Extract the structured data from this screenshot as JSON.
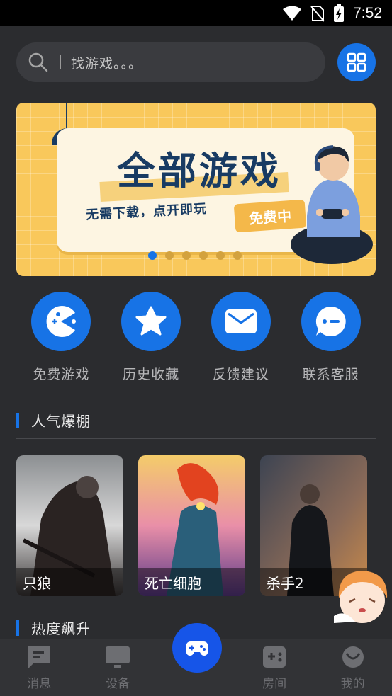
{
  "status_bar": {
    "time": "7:52"
  },
  "search": {
    "placeholder": "找游戏。。。"
  },
  "banner": {
    "title": "全部游戏",
    "subtitle": "无需下载，点开即玩",
    "badge": "免费中",
    "slides": 6,
    "active_slide": 1
  },
  "actions": [
    {
      "label": "免费游戏",
      "icon": "pacman-icon"
    },
    {
      "label": "历史收藏",
      "icon": "star-icon"
    },
    {
      "label": "反馈建议",
      "icon": "mail-icon"
    },
    {
      "label": "联系客服",
      "icon": "chat-icon"
    }
  ],
  "sections": {
    "popular": "人气爆棚",
    "rising": "热度飙升"
  },
  "games": [
    {
      "title": "只狼"
    },
    {
      "title": "死亡细胞"
    },
    {
      "title": "杀手2"
    }
  ],
  "bottom_nav": [
    {
      "label": "消息",
      "icon": "message-icon"
    },
    {
      "label": "设备",
      "icon": "monitor-icon"
    },
    {
      "label": "",
      "icon": "gamepad-icon"
    },
    {
      "label": "房间",
      "icon": "room-icon"
    },
    {
      "label": "我的",
      "icon": "profile-icon"
    }
  ],
  "colors": {
    "accent": "#1773e6",
    "background": "#2b2c2f",
    "fab": "#1655e8"
  }
}
